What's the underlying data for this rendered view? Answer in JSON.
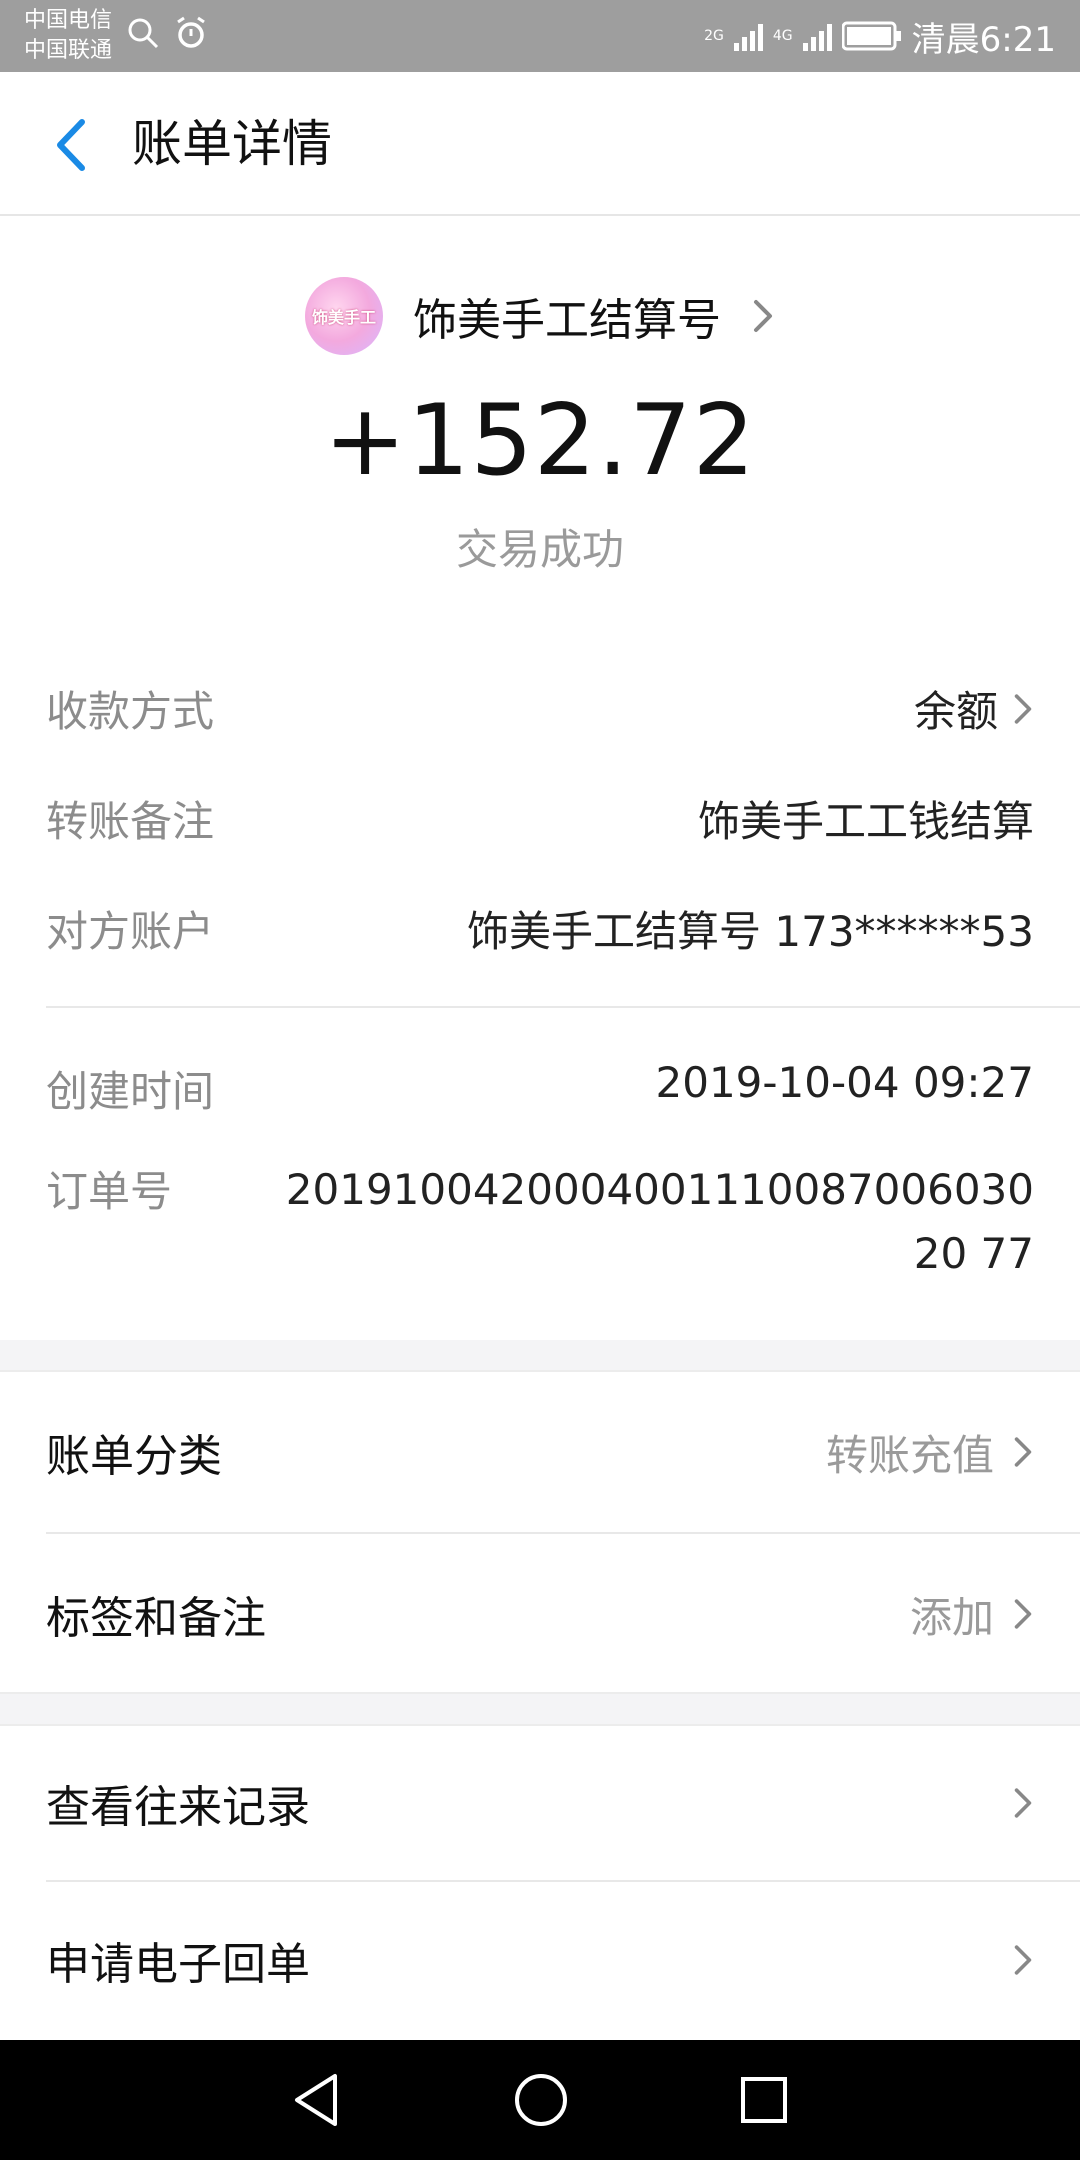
{
  "status_bar": {
    "carrier1": "中国电信",
    "carrier2": "中国联通",
    "net1": "2G",
    "net2": "4G",
    "time": "清晨6:21"
  },
  "header": {
    "title": "账单详情"
  },
  "payee": {
    "avatar_text": "饰美手工",
    "name": "饰美手工结算号"
  },
  "transaction": {
    "amount": "+152.72",
    "status": "交易成功"
  },
  "details": [
    {
      "label": "收款方式",
      "value": "余额"
    },
    {
      "label": "转账备注",
      "value": "饰美手工工钱结算"
    },
    {
      "label": "对方账户",
      "value": "饰美手工结算号 173******53"
    },
    {
      "label": "创建时间",
      "value": "2019-10-04 09:27"
    },
    {
      "label": "订单号",
      "value": "2019100420004001110087006030 2077"
    }
  ],
  "order_number": "201910042000400111008700603020 77",
  "section1": [
    {
      "label": "账单分类",
      "value": "转账充值"
    },
    {
      "label": "标签和备注",
      "value": "添加"
    }
  ],
  "section2": [
    {
      "label": "查看往来记录"
    },
    {
      "label": "申请电子回单"
    }
  ],
  "colors": {
    "accent": "#1a8ae5",
    "status_bar": "#9e9e9e",
    "muted": "#9a9a9a"
  }
}
